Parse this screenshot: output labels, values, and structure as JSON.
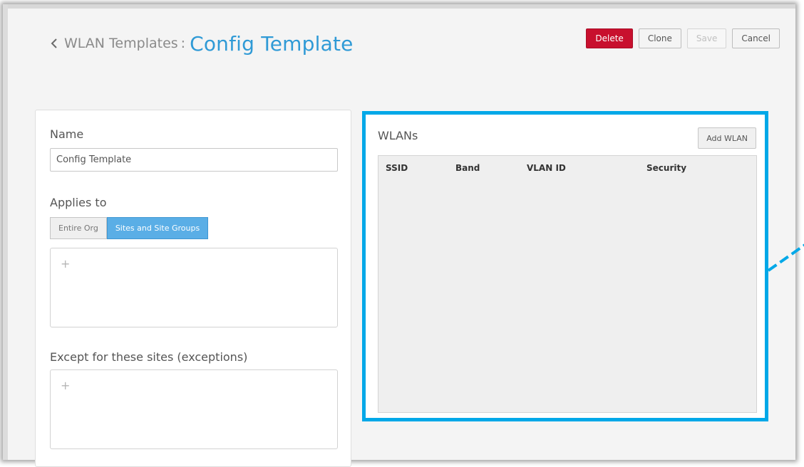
{
  "header": {
    "breadcrumb_parent": "WLAN Templates",
    "separator": ":",
    "title": "Config Template"
  },
  "actions": {
    "delete_label": "Delete",
    "clone_label": "Clone",
    "save_label": "Save",
    "cancel_label": "Cancel"
  },
  "form": {
    "name_label": "Name",
    "name_value": "Config Template",
    "applies_to_label": "Applies to",
    "applies_to_options": [
      "Entire Org",
      "Sites and Site Groups"
    ],
    "applies_to_selected": "Sites and Site Groups",
    "exceptions_label": "Except for these sites (exceptions)",
    "add_symbol": "+"
  },
  "wlans": {
    "title": "WLANs",
    "add_button": "Add WLAN",
    "columns": [
      "SSID",
      "Band",
      "VLAN ID",
      "Security"
    ],
    "rows": []
  },
  "colors": {
    "accent": "#2f9ad6",
    "highlight_border": "#00a8e8",
    "delete": "#c8102e",
    "toggle_active": "#5aaee6"
  },
  "icons": {
    "back": "chevron-left-icon",
    "add": "plus-icon"
  }
}
